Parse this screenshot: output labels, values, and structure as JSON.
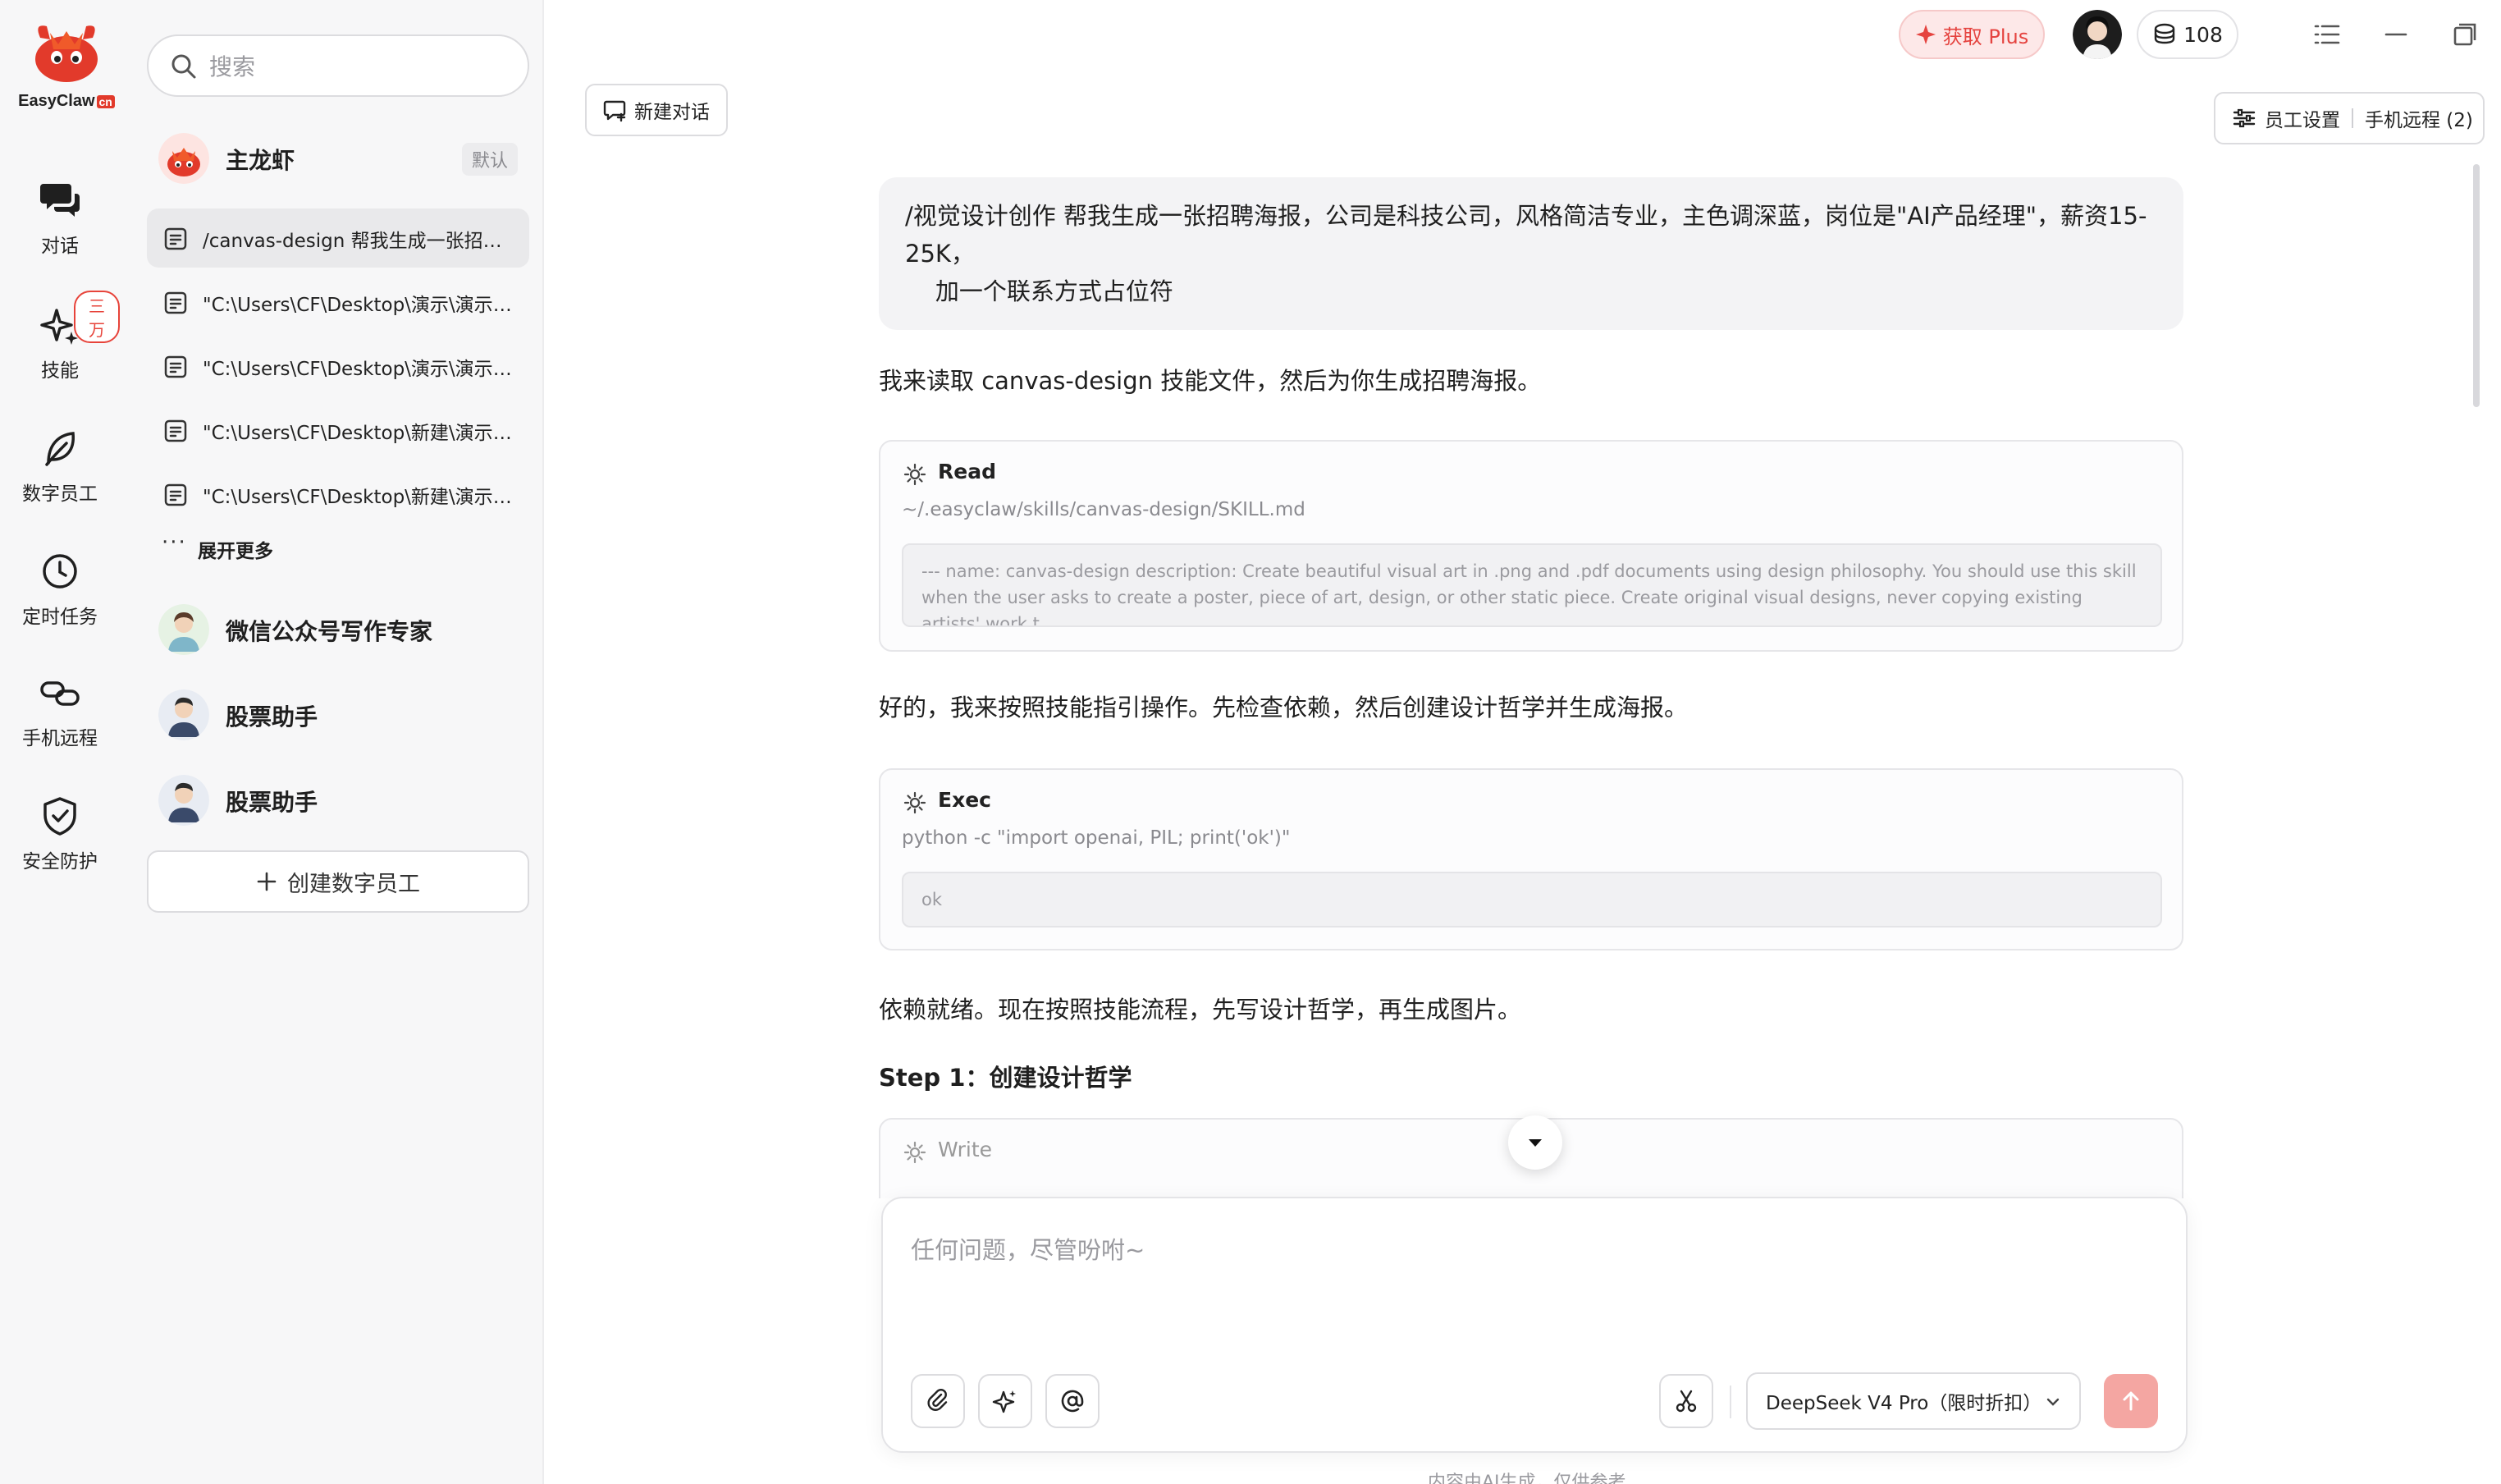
{
  "app": {
    "name": "EasyClaw",
    "name_suffix": "cn"
  },
  "rail": {
    "items": [
      {
        "label": "对话",
        "icon": "chat-bubbles-icon"
      },
      {
        "label": "技能",
        "icon": "sparkle-icon",
        "badge": "三万"
      },
      {
        "label": "数字员工",
        "icon": "leaf-icon"
      },
      {
        "label": "定时任务",
        "icon": "clock-icon"
      },
      {
        "label": "手机远程",
        "icon": "link-icon"
      },
      {
        "label": "安全防护",
        "icon": "shield-check-icon"
      }
    ]
  },
  "sidebar": {
    "search_placeholder": "搜索",
    "main_agent": {
      "name": "主龙虾",
      "badge": "默认"
    },
    "conversations": [
      "/canvas-design 帮我生成一张招聘海报，公司是科技公司",
      "\"C:\\Users\\CF\\Desktop\\演示\\演示.txt\"",
      "\"C:\\Users\\CF\\Desktop\\演示\\演示.txt\"",
      "\"C:\\Users\\CF\\Desktop\\新建\\演示.txt\"",
      "\"C:\\Users\\CF\\Desktop\\新建\\演示.txt\""
    ],
    "more_dots": "···",
    "more_label": "展开更多",
    "agents": [
      {
        "name": "微信公众号写作专家"
      },
      {
        "name": "股票助手"
      },
      {
        "name": "股票助手"
      }
    ],
    "create_label": "创建数字员工"
  },
  "topbar": {
    "plus_label": "获取 Plus",
    "credits": "108",
    "new_chat_label": "新建对话",
    "employee_settings_label": "员工设置",
    "mobile_remote_label": "手机远程 (2)"
  },
  "chat": {
    "user_message": "/视觉设计创作 帮我生成一张招聘海报，公司是科技公司，风格简洁专业，主色调深蓝，岗位是\"AI产品经理\"，薪资15-25K，\n    加一个联系方式占位符",
    "ai_text_1": "我来读取 canvas-design 技能文件，然后为你生成招聘海报。",
    "tool_read": {
      "name": "Read",
      "command": "~/.easyclaw/skills/canvas-design/SKILL.md",
      "output": "--- name: canvas-design description: Create beautiful visual art in .png and .pdf documents using design philosophy. You should use this skill when the user asks to create a poster, piece of art, design, or other static piece. Create original visual designs, never copying existing artists' work t..."
    },
    "ai_text_2": "好的，我来按照技能指引操作。先检查依赖，然后创建设计哲学并生成海报。",
    "tool_exec": {
      "name": "Exec",
      "command": "python -c \"import openai, PIL; print('ok')\"",
      "output": "ok"
    },
    "ai_text_3": "依赖就绪。现在按照技能流程，先写设计哲学，再生成图片。",
    "step_label": "Step 1：创建设计哲学",
    "tool_write": {
      "name": "Write"
    }
  },
  "composer": {
    "placeholder": "任何问题，尽管吩咐~",
    "model": "DeepSeek V4 Pro（限时折扣）"
  },
  "disclaimer": "内容由AI生成，仅供参考",
  "colors": {
    "accent": "#e5433f",
    "send_disabled": "#f4a6a2"
  }
}
